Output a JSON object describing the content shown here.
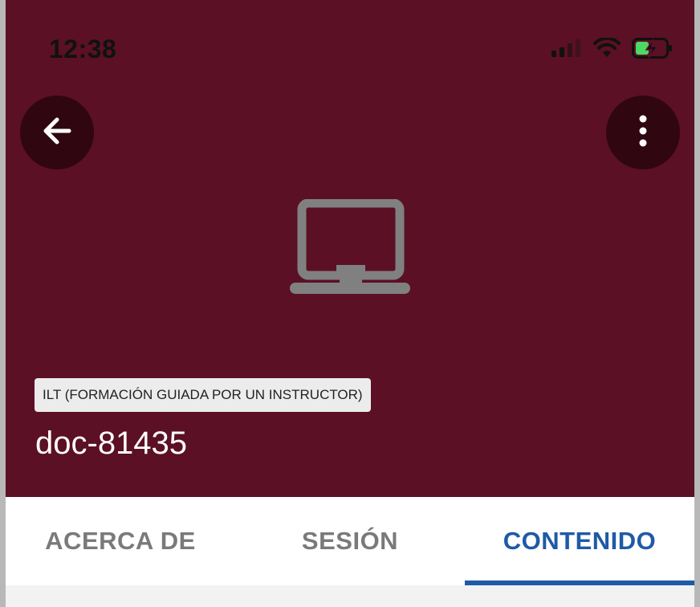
{
  "status_bar": {
    "time": "12:38",
    "icons": [
      "cellular-signal-icon",
      "wifi-icon",
      "battery-charging-icon"
    ],
    "battery_color": "#4cd964"
  },
  "header": {
    "back_icon": "arrow-left-icon",
    "more_icon": "more-vertical-icon",
    "hero_icon": "laptop-icon",
    "type_badge": "ILT (FORMACIÓN GUIADA POR UN INSTRUCTOR)",
    "title": "doc-81435",
    "background_color": "#5b1025"
  },
  "tabs": [
    {
      "label": "ACERCA DE",
      "active": false
    },
    {
      "label": "SESIÓN",
      "active": false
    },
    {
      "label": "CONTENIDO",
      "active": true
    }
  ],
  "colors": {
    "accent": "#1f5aa6",
    "inactive_tab": "#7a7a7a"
  }
}
